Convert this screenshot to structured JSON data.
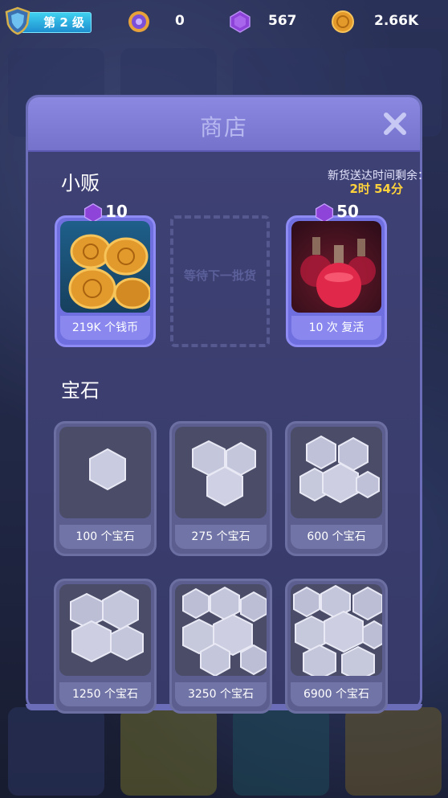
{
  "hud": {
    "level": "第 2 级",
    "lives": "0",
    "gems": "567",
    "coins": "2.66K"
  },
  "shop": {
    "title": "商店",
    "vendor_title": "小贩",
    "timer_label": "新货送达时间剩余：",
    "timer_value": "2时 54分",
    "placeholder_text": "等待下一批货",
    "offers": [
      {
        "price": "10",
        "label": "219K 个钱币",
        "icon": "coin-pile-icon"
      },
      {
        "price": "50",
        "label": "10 次 复活",
        "icon": "potion-icon"
      }
    ],
    "gems_title": "宝石",
    "gem_packs": [
      {
        "label": "100 个宝石"
      },
      {
        "label": "275 个宝石"
      },
      {
        "label": "600 个宝石"
      },
      {
        "label": "1250 个宝石"
      },
      {
        "label": "3250 个宝石"
      },
      {
        "label": "6900 个宝石"
      }
    ]
  },
  "colors": {
    "panel": "#4b4f8e",
    "header": "#7572cc",
    "offer_card": "#6f6fe0",
    "timer": "#ffd23c",
    "gem": "#8e44d8"
  }
}
